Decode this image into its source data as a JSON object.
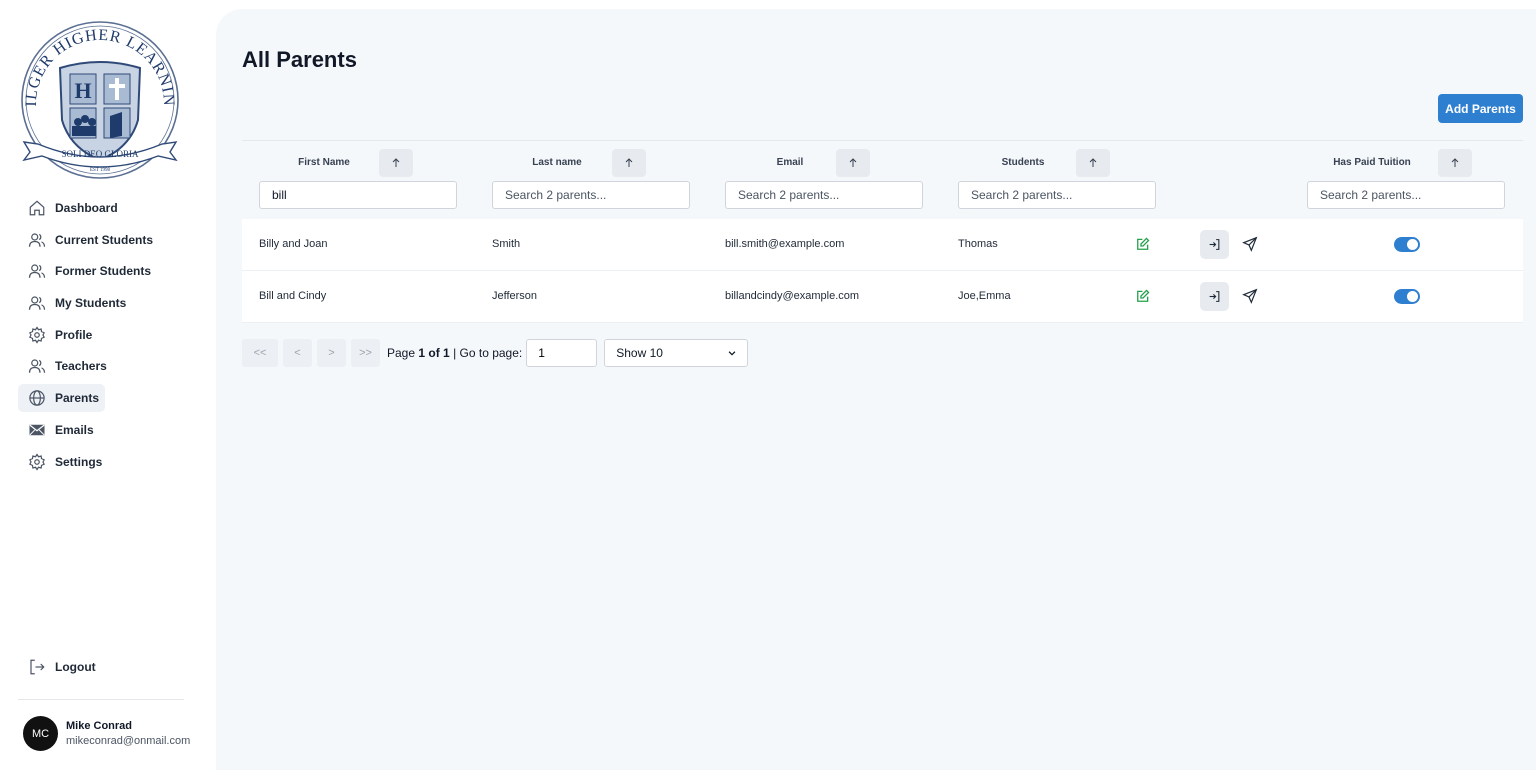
{
  "sidebar": {
    "logo": {
      "arc_text": "HILGER HIGHER LEARNING",
      "banner_text": "SOLI DEO GLORIA",
      "est_text": "EST 1998",
      "shield_letter": "H"
    },
    "items": [
      {
        "label": "Dashboard",
        "icon": "home-icon"
      },
      {
        "label": "Current Students",
        "icon": "users-icon"
      },
      {
        "label": "Former Students",
        "icon": "users-icon"
      },
      {
        "label": "My Students",
        "icon": "users-icon"
      },
      {
        "label": "Profile",
        "icon": "gear-icon"
      },
      {
        "label": "Teachers",
        "icon": "users-icon"
      },
      {
        "label": "Parents",
        "icon": "globe-icon",
        "active": true
      },
      {
        "label": "Emails",
        "icon": "mail-icon"
      },
      {
        "label": "Settings",
        "icon": "gear-icon"
      }
    ],
    "logout_label": "Logout",
    "user": {
      "initials": "MC",
      "name": "Mike Conrad",
      "email": "mikeconrad@onmail.com"
    }
  },
  "main": {
    "title": "All Parents",
    "add_button": "Add Parents",
    "columns": [
      {
        "label": "First Name",
        "filter_value": "bill",
        "filter_placeholder": "Search 2 parents..."
      },
      {
        "label": "Last name",
        "filter_value": "",
        "filter_placeholder": "Search 2 parents..."
      },
      {
        "label": "Email",
        "filter_value": "",
        "filter_placeholder": "Search 2 parents..."
      },
      {
        "label": "Students",
        "filter_value": "",
        "filter_placeholder": "Search 2 parents..."
      },
      {
        "label": "Has Paid Tuition",
        "filter_value": "",
        "filter_placeholder": "Search 2 parents..."
      }
    ],
    "rows": [
      {
        "first_name": "Billy and Joan",
        "last_name": "Smith",
        "email": "bill.smith@example.com",
        "students": "Thomas",
        "paid": true
      },
      {
        "first_name": "Bill and Cindy",
        "last_name": "Jefferson",
        "email": "billandcindy@example.com",
        "students": "Joe,Emma",
        "paid": true
      }
    ],
    "pagination": {
      "first": "<<",
      "prev": "<",
      "next": ">",
      "last": ">>",
      "page_prefix": "Page",
      "page_of": "1 of 1",
      "goto_label": "| Go to page:",
      "goto_value": "1",
      "show_label": "Show 10"
    }
  },
  "colors": {
    "accent": "#2f7fd1",
    "edit": "#22a04a",
    "main_bg": "#f5f8fb"
  }
}
